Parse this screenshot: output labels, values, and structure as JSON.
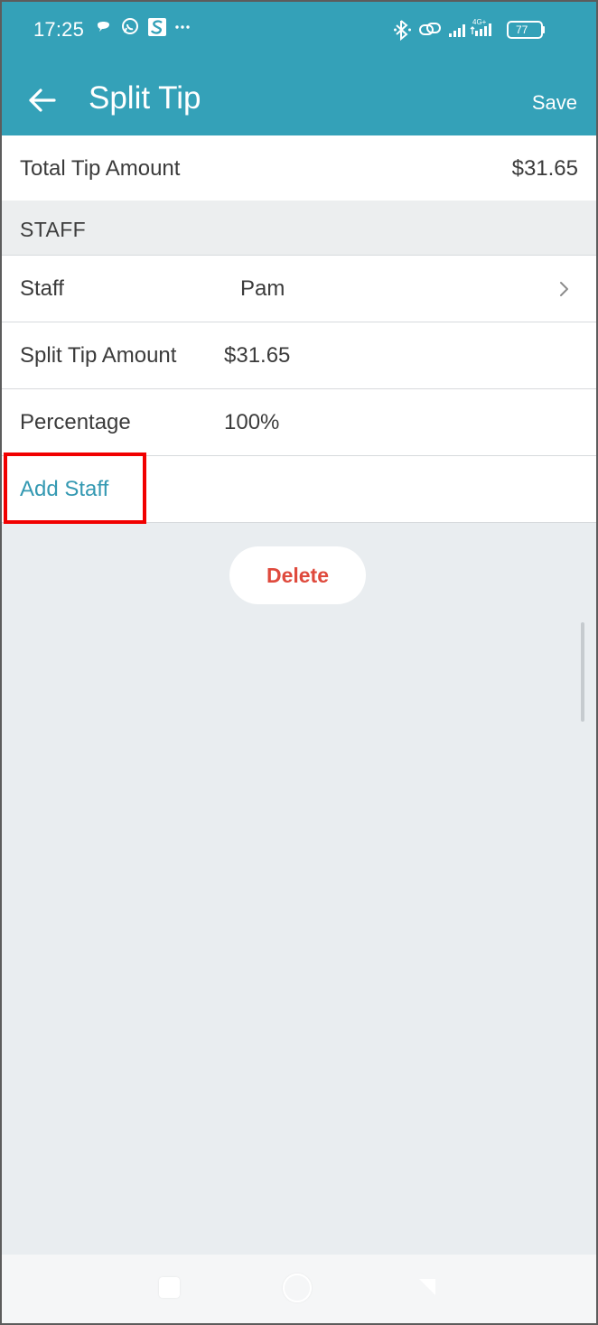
{
  "status_bar": {
    "time": "17:25",
    "network_label": "4G+",
    "battery_level": "77",
    "left_icons": [
      "message-icon",
      "whatsapp-icon",
      "s-app-icon",
      "more-dots-icon"
    ],
    "right_icons": [
      "bluetooth-icon",
      "link-icon",
      "signal-icon",
      "signal-4g-icon",
      "battery-icon"
    ]
  },
  "header": {
    "title": "Split Tip",
    "save_label": "Save",
    "back_icon": "back-arrow-icon",
    "background_color": "#34a1b8"
  },
  "total_tip": {
    "label": "Total Tip Amount",
    "value": "$31.65"
  },
  "staff_section": {
    "header": "STAFF",
    "staff_label": "Staff",
    "staff_value": "Pam",
    "split_label": "Split Tip Amount",
    "split_value": "$31.65",
    "percentage_label": "Percentage",
    "percentage_value": "100%",
    "add_staff_label": "Add Staff"
  },
  "actions": {
    "delete_label": "Delete"
  },
  "nav_bar": {
    "icons": [
      "recent-apps-icon",
      "home-icon",
      "back-icon"
    ]
  },
  "colors": {
    "accent": "#34a1b8",
    "link": "#3499b2",
    "danger": "#df4a3d",
    "highlight": "#f10000"
  }
}
